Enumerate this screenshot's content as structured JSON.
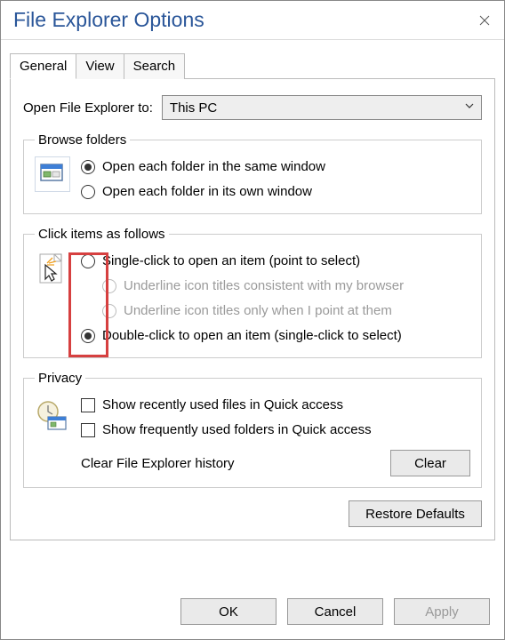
{
  "window": {
    "title": "File Explorer Options"
  },
  "tabs": {
    "general": "General",
    "view": "View",
    "search": "Search"
  },
  "open_to": {
    "label": "Open File Explorer to:",
    "value": "This PC"
  },
  "browse_folders": {
    "legend": "Browse folders",
    "opt_same": "Open each folder in the same window",
    "opt_own": "Open each folder in its own window"
  },
  "click_items": {
    "legend": "Click items as follows",
    "opt_single": "Single-click to open an item (point to select)",
    "opt_sub_browser": "Underline icon titles consistent with my browser",
    "opt_sub_point": "Underline icon titles only when I point at them",
    "opt_double": "Double-click to open an item (single-click to select)"
  },
  "privacy": {
    "legend": "Privacy",
    "chk_recent": "Show recently used files in Quick access",
    "chk_frequent": "Show frequently used folders in Quick access",
    "clear_label": "Clear File Explorer history",
    "clear_btn": "Clear"
  },
  "restore": "Restore Defaults",
  "footer": {
    "ok": "OK",
    "cancel": "Cancel",
    "apply": "Apply"
  }
}
